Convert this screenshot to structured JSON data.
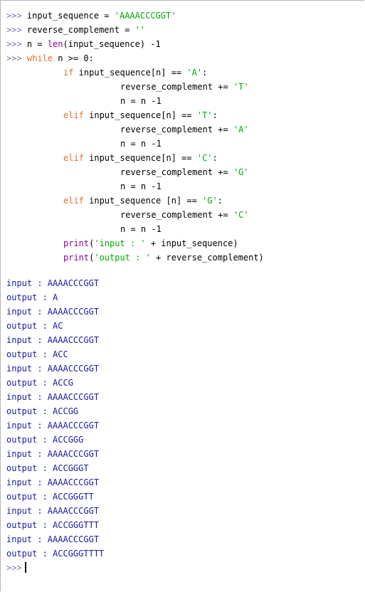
{
  "prompt": ">>>",
  "code": {
    "l1": {
      "name": "input_sequence = ",
      "str": "'AAAACCCGGT'"
    },
    "l2": {
      "name": "reverse_complement = ",
      "str": "''"
    },
    "l3": {
      "a": "n = ",
      "fn": "len",
      "b": "(input_sequence) -1"
    },
    "l4": {
      "kw": "while",
      "rest": " n >= 0:"
    },
    "blocks": [
      {
        "kw": "if",
        "cond": " input_sequence[n] == ",
        "cmp": "'A'",
        "colon": ":",
        "assign": "reverse_complement += ",
        "val": "'T'",
        "dec": "n = n -1"
      },
      {
        "kw": "elif",
        "cond": " input_sequence[n] == ",
        "cmp": "'T'",
        "colon": ":",
        "assign": "reverse_complement += ",
        "val": "'A'",
        "dec": "n = n -1"
      },
      {
        "kw": "elif",
        "cond": " input_sequence[n] == ",
        "cmp": "'C'",
        "colon": ":",
        "assign": "reverse_complement += ",
        "val": "'G'",
        "dec": "n = n -1"
      },
      {
        "kw": "elif",
        "cond": " input_sequence [n] == ",
        "cmp": "'G'",
        "colon": ":",
        "assign": "reverse_complement += ",
        "val": "'C'",
        "dec": "n = n -1"
      }
    ],
    "print1": {
      "fn": "print",
      "open": "(",
      "str": "'input : '",
      "rest": " + input_sequence)"
    },
    "print2": {
      "fn": "print",
      "open": "(",
      "str": "'output : '",
      "rest": " + reverse_complement)"
    }
  },
  "output": [
    "input : AAAACCCGGT",
    "output : A",
    "input : AAAACCCGGT",
    "output : AC",
    "input : AAAACCCGGT",
    "output : ACC",
    "input : AAAACCCGGT",
    "output : ACCG",
    "input : AAAACCCGGT",
    "output : ACCGG",
    "input : AAAACCCGGT",
    "output : ACCGGG",
    "input : AAAACCCGGT",
    "output : ACCGGGT",
    "input : AAAACCCGGT",
    "output : ACCGGGTT",
    "input : AAAACCCGGT",
    "output : ACCGGGTTT",
    "input : AAAACCCGGT",
    "output : ACCGGGTTTT"
  ],
  "colors": {
    "keyword": "#e6702e",
    "string": "#00aa00",
    "builtin": "#900090",
    "output": "#1a1aa6",
    "prompt": "#7a7ab0"
  }
}
